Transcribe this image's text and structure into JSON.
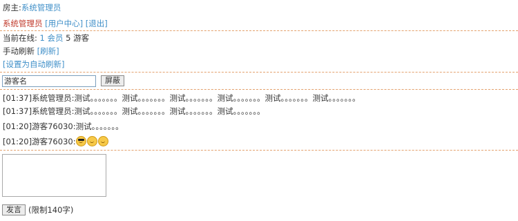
{
  "header": {
    "owner_label": "房主:",
    "owner_name": "系统管理员"
  },
  "user_bar": {
    "username": "系统管理员",
    "user_center": "[用户中心]",
    "logout": "[退出]"
  },
  "status": {
    "online_label": "当前在线:",
    "members_count": "1",
    "members_label": "会员",
    "guests_count": "5",
    "guests_label": "游客"
  },
  "refresh": {
    "manual_label": "手动刷新",
    "refresh_link": "[刷新]",
    "auto_link": "[设置为自动刷新]"
  },
  "block": {
    "input_value": "游客名",
    "button_label": "屏蔽"
  },
  "messages": [
    {
      "text": "[01:37]系统管理员:测试。。。。。。。测试。。。。。。。测试。。。。。。。测试。。。。。。。测试。。。。。。。测试。。。。。。。"
    },
    {
      "text": "[01:37]系统管理员:测试。。。。。。。测试。。。。。。。测试。。。。。。。测试。。。。。。。"
    },
    {
      "text": "[01:20]游客76030:测试。。。。。。。"
    },
    {
      "text": "[01:20]游客76030:",
      "emojis": [
        "sunglasses-emoji",
        "smile-emoji",
        "grin-emoji"
      ]
    }
  ],
  "composer": {
    "textarea_value": "",
    "send_label": "发言",
    "limit_note": "(限制140字)"
  }
}
